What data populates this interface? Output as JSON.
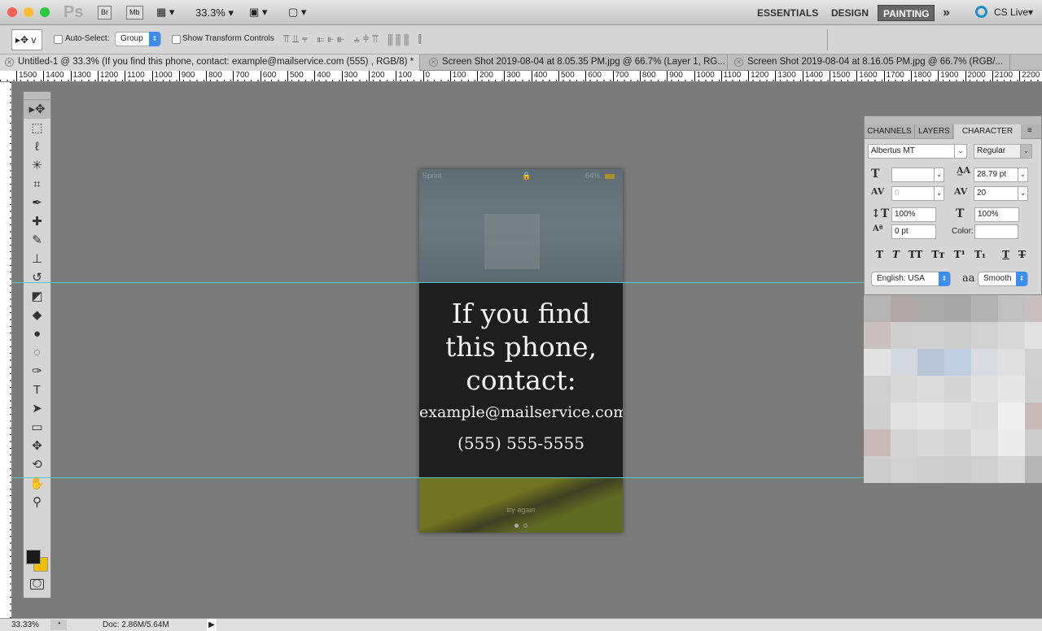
{
  "titlebar": {
    "app_logo": "Ps",
    "bridge": "Br",
    "minibridge": "Mb",
    "zoom": "33.3%",
    "workspaces": [
      "ESSENTIALS",
      "DESIGN",
      "PAINTING"
    ],
    "active_workspace": "PAINTING",
    "more": "»",
    "cs_live": "CS Live"
  },
  "options": {
    "tool_preset": "v",
    "auto_select_label": "Auto-Select:",
    "auto_select_value": "Group",
    "show_transform_label": "Show Transform Controls"
  },
  "tabs": [
    {
      "label": "Untitled-1 @ 33.3% (If you find this phone, contact: example@mailservice.com (555) , RGB/8) *",
      "active": true
    },
    {
      "label": "Screen Shot 2019-08-04 at 8.05.35 PM.jpg @ 66.7% (Layer 1, RG...",
      "active": false
    },
    {
      "label": "Screen Shot 2019-08-04 at 8.16.05 PM.jpg @ 66.7% (RGB/...",
      "active": false
    }
  ],
  "ruler": {
    "labels": [
      "1500",
      "1400",
      "1300",
      "1200",
      "1100",
      "1000",
      "900",
      "800",
      "700",
      "600",
      "500",
      "400",
      "300",
      "200",
      "100",
      "0",
      "100",
      "200",
      "300",
      "400",
      "500",
      "600",
      "700",
      "800",
      "900",
      "1000",
      "1100",
      "1200",
      "1300",
      "1400",
      "1500",
      "1600",
      "1700",
      "1800",
      "1900",
      "2000",
      "2100",
      "2200"
    ]
  },
  "tools": [
    "move-icon",
    "marquee-icon",
    "lasso-icon",
    "magic-wand-icon",
    "crop-icon",
    "eyedropper-icon",
    "healing-brush-icon",
    "brush-icon",
    "clone-stamp-icon",
    "history-brush-icon",
    "eraser-icon",
    "paint-bucket-icon",
    "blur-icon",
    "dodge-icon",
    "pen-icon",
    "type-icon",
    "path-selection-icon",
    "rectangle-icon",
    "3d-rotate-icon",
    "3d-orbit-icon",
    "hand-icon",
    "zoom-icon"
  ],
  "colors": {
    "foreground": "#1a1a1a",
    "background": "#f0c000",
    "guide": "#4cc9c9",
    "accent": "#3b8ef0"
  },
  "document": {
    "carrier": "Sprint",
    "battery": "64%",
    "line1": "If you find",
    "line2": "this phone,",
    "line3": "contact:",
    "email": "example@mailservice.com",
    "phone": "(555) 555-5555",
    "try_again": "try again"
  },
  "character": {
    "tabs": [
      "CHANNELS",
      "LAYERS",
      "CHARACTER"
    ],
    "active_tab": "CHARACTER",
    "font_family": "Albertus MT",
    "font_style": "Regular",
    "font_size": "",
    "leading": "28.79 pt",
    "kerning": "0",
    "tracking": "20",
    "vertical_scale": "100%",
    "horizontal_scale": "100%",
    "baseline_shift": "0 pt",
    "color_label": "Color:",
    "language": "English: USA",
    "aa_label": "aa",
    "antialias": "Smooth",
    "style_buttons": [
      "T",
      "T",
      "TT",
      "Tт",
      "T¹",
      "T₁",
      "T",
      "T"
    ]
  },
  "status": {
    "zoom": "33.33%",
    "doc": "Doc: 2.86M/5.64M"
  }
}
